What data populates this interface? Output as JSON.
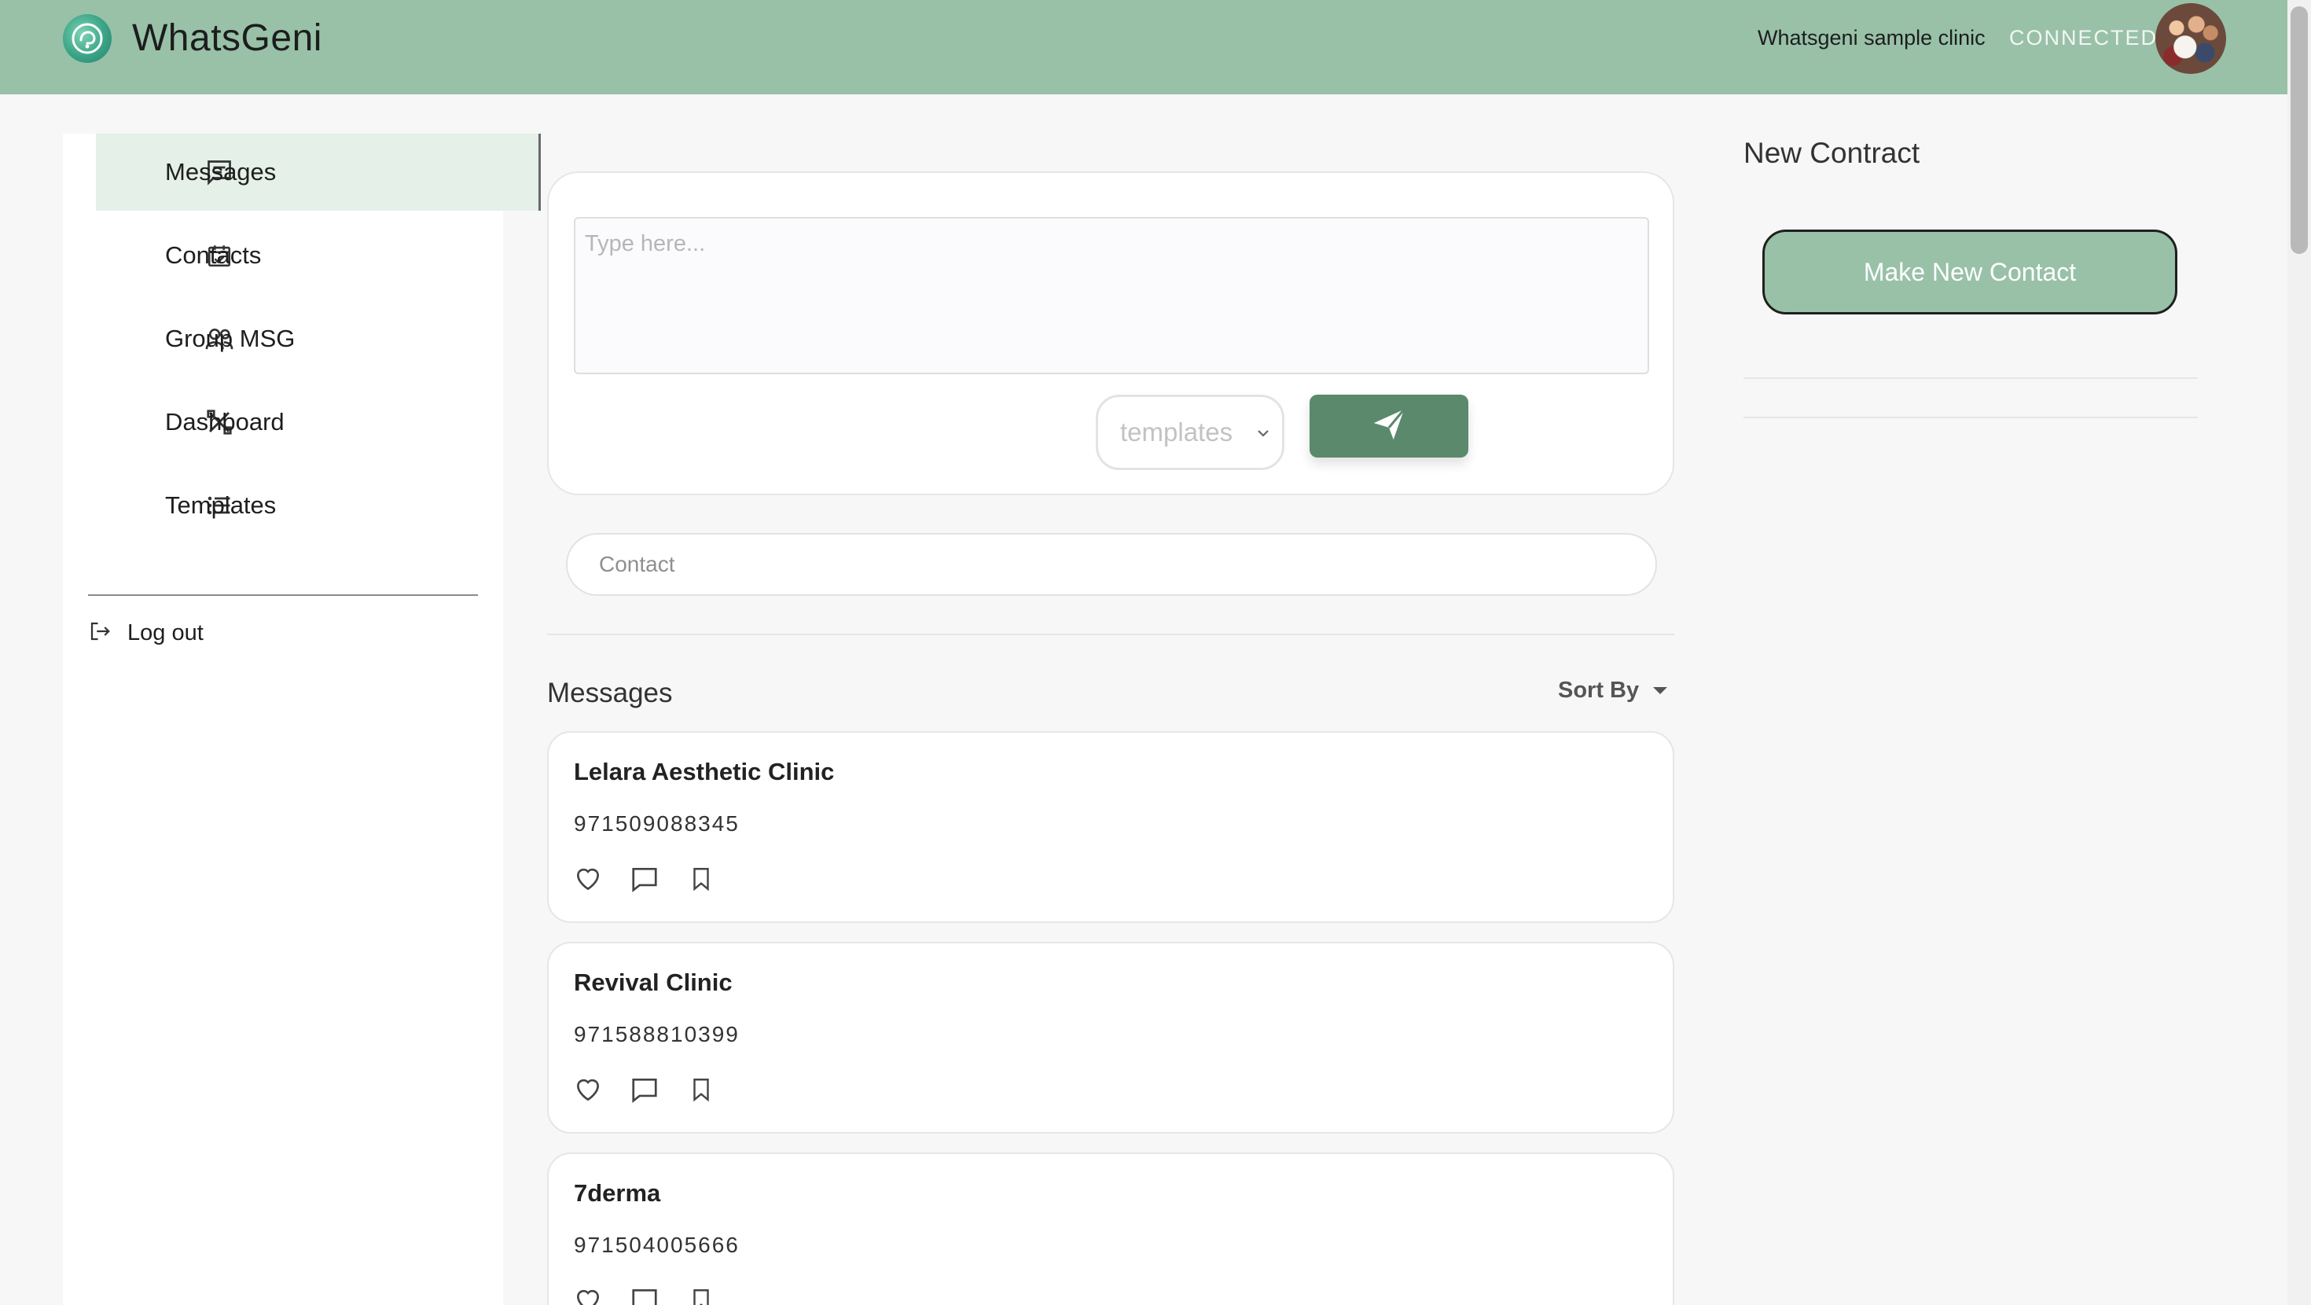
{
  "header": {
    "app_title": "WhatsGeni",
    "clinic_name": "Whatsgeni sample clinic",
    "connection_status": "CONNECTED",
    "brand_color": "#98c1a8"
  },
  "sidebar": {
    "items": [
      {
        "label": "Messages",
        "icon": "message-icon",
        "active": true
      },
      {
        "label": "Contacts",
        "icon": "calendar-check-icon",
        "active": false
      },
      {
        "label": "Group MSG",
        "icon": "group-icon",
        "active": false
      },
      {
        "label": "Dashboard",
        "icon": "tools-icon",
        "active": false
      },
      {
        "label": "Templates",
        "icon": "list-icon",
        "active": false
      }
    ],
    "logout_label": "Log out"
  },
  "composer": {
    "textarea_placeholder": "Type here...",
    "template_select_value": "templates",
    "send_icon": "send-icon",
    "send_color": "#5a8a6b"
  },
  "contact_field": {
    "placeholder": "Contact"
  },
  "messages": {
    "title": "Messages",
    "sort_label": "Sort By",
    "cards": [
      {
        "name": "Lelara Aesthetic Clinic",
        "phone": "971509088345"
      },
      {
        "name": "Revival Clinic",
        "phone": "971588810399"
      },
      {
        "name": "7derma",
        "phone": "971504005666"
      }
    ]
  },
  "right_panel": {
    "title": "New Contract",
    "make_contact_label": "Make New Contact"
  }
}
